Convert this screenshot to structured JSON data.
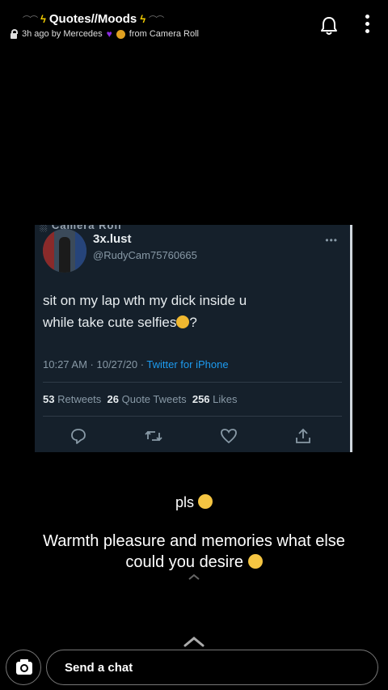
{
  "header": {
    "title": "Quotes//Moods",
    "meta_time": "3h ago by Mercedes",
    "meta_source": "from Camera Roll",
    "accent_bolt": "#f7d000"
  },
  "tweet": {
    "cut_text": "░ Camera Roll",
    "username": "3x.lust",
    "handle": "@RudyCam75760665",
    "text_line1": "sit on my lap wth my dick inside u",
    "text_line2_a": "while take cute selfies",
    "text_line2_b": "?",
    "time_date": "10:27 AM · 10/27/20 · ",
    "source": "Twitter for iPhone",
    "retweets_count": "53",
    "retweets_label": "Retweets",
    "quotes_count": "26",
    "quotes_label": "Quote Tweets",
    "likes_count": "256",
    "likes_label": "Likes"
  },
  "captions": {
    "line1": "pls",
    "line2": "Warmth pleasure and memories what else could you desire"
  },
  "footer": {
    "chat_placeholder": "Send a chat"
  },
  "icons": {
    "bell": "bell-icon",
    "more": "more-vertical-icon",
    "lock": "lock-icon",
    "camera": "camera-icon",
    "reply": "reply-icon",
    "retweet": "retweet-icon",
    "like": "heart-icon",
    "share": "share-icon"
  },
  "colors": {
    "background": "#000000",
    "tweet_bg": "#15202b",
    "link_blue": "#1d9bf0"
  }
}
